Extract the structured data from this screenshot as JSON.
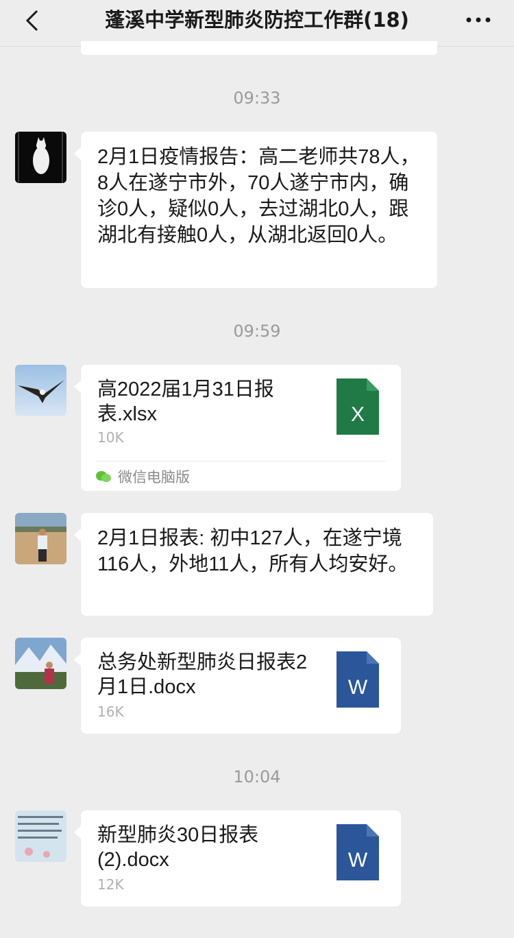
{
  "header": {
    "title": "蓬溪中学新型肺炎防控工作群(18)",
    "back_icon": "chevron-left-icon",
    "more_icon": "more-dots-icon"
  },
  "messages": [
    {
      "time": "09:33",
      "type": "text",
      "text": "2月1日疫情报告：高二老师共78人，8人在遂宁市外，70人遂宁市内，确诊0人，疑似0人，去过湖北0人，跟湖北有接触0人，从湖北返回0人。"
    },
    {
      "time": "09:59",
      "type": "file",
      "file_name": "高2022届1月31日报表.xlsx",
      "file_size": "10K",
      "file_icon": "excel-file-icon",
      "file_letter": "X",
      "source": "微信电脑版"
    },
    {
      "type": "text",
      "text": "2月1日报表: 初中127人，在遂宁境116人，外地11人，所有人均安好。"
    },
    {
      "type": "file",
      "file_name": "总务处新型肺炎日报表2月1日.docx",
      "file_size": "16K",
      "file_icon": "word-file-icon",
      "file_letter": "W"
    },
    {
      "time": "10:04",
      "type": "file",
      "file_name": "新型肺炎30日报表(2).docx",
      "file_size": "12K",
      "file_icon": "word-file-icon",
      "file_letter": "W"
    }
  ],
  "colors": {
    "background": "#ededed",
    "excel_green": "#1f7a45",
    "word_blue": "#2b579a",
    "wechat_green": "#5bc236"
  }
}
